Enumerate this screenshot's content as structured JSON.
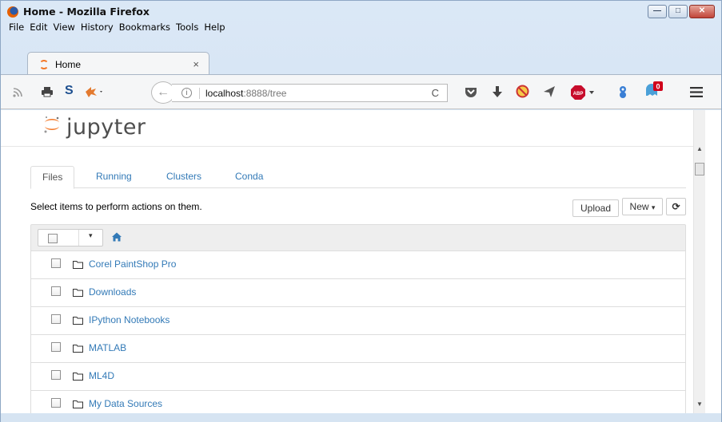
{
  "window": {
    "title": "Home - Mozilla Firefox",
    "controls": {
      "minimize": "—",
      "maximize": "□",
      "close": "✕"
    }
  },
  "menubar": [
    "File",
    "Edit",
    "View",
    "History",
    "Bookmarks",
    "Tools",
    "Help"
  ],
  "browser_tab": {
    "label": "Home",
    "close": "×"
  },
  "toolbar": {
    "url_host": "localhost",
    "url_rest": ":8888/tree",
    "info": "i",
    "reload": "C",
    "abp_label": "ABP",
    "badge_count": "0",
    "icons": [
      "rss-icon",
      "printer-icon",
      "s-icon",
      "extension-icon",
      "pocket-icon",
      "download-icon",
      "block-icon",
      "send-icon",
      "adblock-icon",
      "puzzle-icon",
      "ghost-icon",
      "menu-icon"
    ]
  },
  "jupyter": {
    "logo_text": "jupyter",
    "tabs": [
      "Files",
      "Running",
      "Clusters",
      "Conda"
    ],
    "active_tab": "Files",
    "instructions": "Select items to perform actions on them.",
    "upload_label": "Upload",
    "new_label": "New",
    "refresh": "⟳",
    "caret": "▾",
    "items": [
      {
        "name": "Corel PaintShop Pro",
        "type": "folder"
      },
      {
        "name": "Downloads",
        "type": "folder"
      },
      {
        "name": "IPython Notebooks",
        "type": "folder"
      },
      {
        "name": "MATLAB",
        "type": "folder"
      },
      {
        "name": "ML4D",
        "type": "folder"
      },
      {
        "name": "My Data Sources",
        "type": "folder"
      }
    ]
  },
  "colors": {
    "link": "#337ab7",
    "jupyter_orange": "#f37726",
    "abp_red": "#c70d2c"
  }
}
